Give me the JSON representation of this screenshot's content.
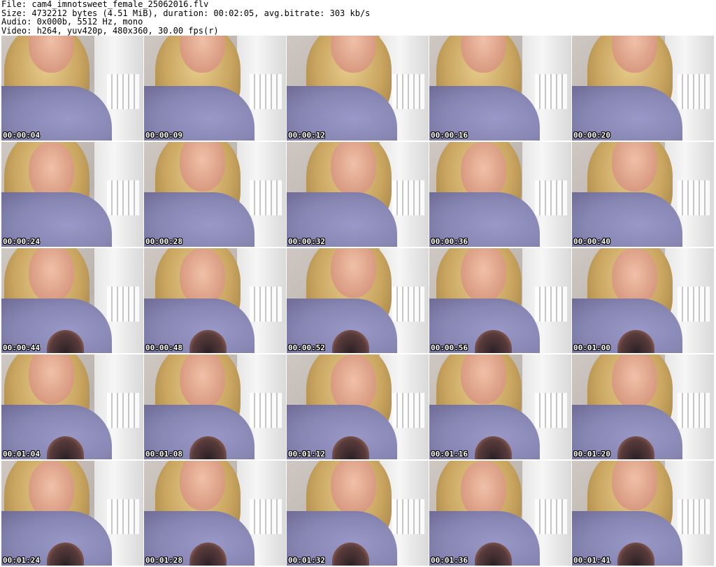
{
  "header": {
    "file_line": "File: cam4_imnotsweet_female_25062016.flv",
    "size_line": "Size: 4732212 bytes (4.51 MiB), duration: 00:02:05, avg.bitrate: 303 kb/s",
    "audio_line": "Audio: 0x000b, 5512 Hz, mono",
    "video_line": "Video: h264, yuv420p, 480x360, 30.00 fps(r)"
  },
  "thumbnails": [
    "00:00:04",
    "00:00:09",
    "00:00:12",
    "00:00:16",
    "00:00:20",
    "00:00:24",
    "00:00:28",
    "00:00:32",
    "00:00:36",
    "00:00:40",
    "00:00:44",
    "00:00:48",
    "00:00:52",
    "00:00:56",
    "00:01:00",
    "00:01:04",
    "00:01:08",
    "00:01:12",
    "00:01:16",
    "00:01:20",
    "00:01:24",
    "00:01:28",
    "00:01:32",
    "00:01:36",
    "00:01:41"
  ]
}
